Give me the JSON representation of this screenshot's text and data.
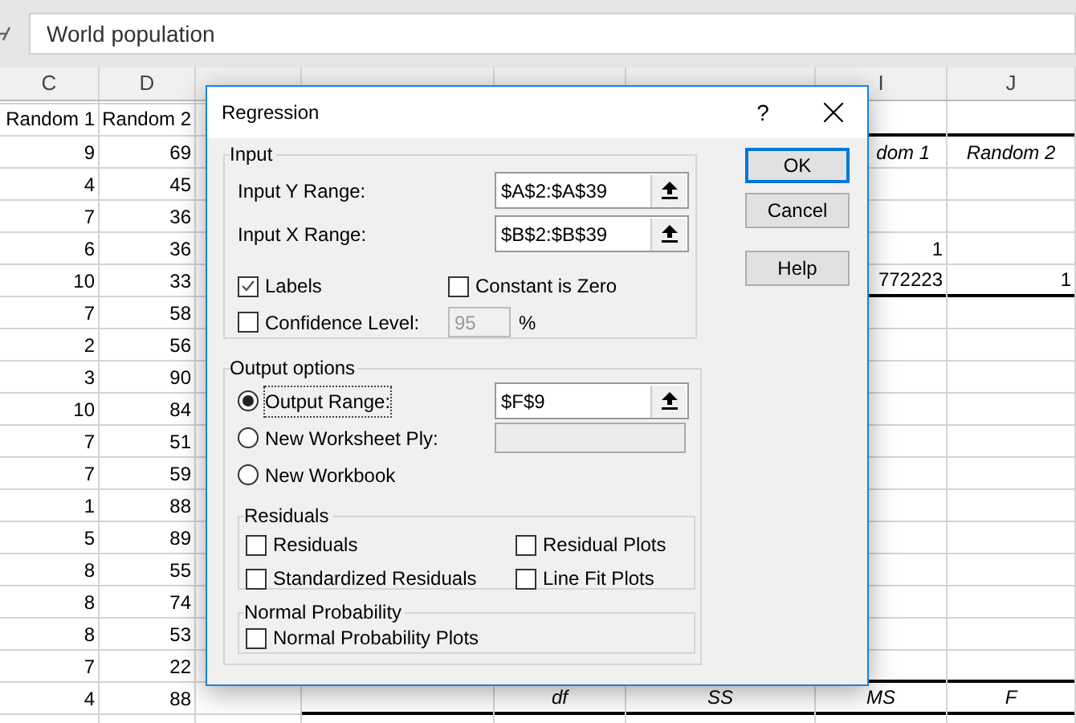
{
  "formula_bar": {
    "value": "World population"
  },
  "columns": [
    {
      "header": "C"
    },
    {
      "header": "D"
    },
    null,
    null,
    null,
    null,
    {
      "header": "I"
    },
    {
      "header": "J"
    }
  ],
  "rows": [
    {
      "cells": [
        {
          "text": "Random 1"
        },
        {
          "text": "Random 2"
        },
        null,
        null,
        null,
        null,
        {
          "rule": true
        },
        {
          "rule": true
        }
      ]
    },
    {
      "cells": [
        {
          "text": "9"
        },
        {
          "text": "69"
        },
        null,
        null,
        null,
        null,
        {
          "text": "dom 1",
          "italic": true,
          "kind": "cut"
        },
        {
          "text": "Random 2",
          "italic": true
        }
      ]
    },
    {
      "cells": [
        {
          "text": "4"
        },
        {
          "text": "45"
        }
      ]
    },
    {
      "cells": [
        {
          "text": "7"
        },
        {
          "text": "36"
        }
      ]
    },
    {
      "cells": [
        {
          "text": "6"
        },
        {
          "text": "36"
        },
        null,
        null,
        null,
        null,
        {
          "text": "1"
        }
      ]
    },
    {
      "cells": [
        {
          "text": "10"
        },
        {
          "text": "33"
        },
        null,
        null,
        null,
        null,
        {
          "text": "772223",
          "rule": true
        },
        {
          "text": "1",
          "rule": true
        }
      ]
    },
    {
      "cells": [
        {
          "text": "7"
        },
        {
          "text": "58"
        }
      ]
    },
    {
      "cells": [
        {
          "text": "2"
        },
        {
          "text": "56"
        }
      ]
    },
    {
      "cells": [
        {
          "text": "3"
        },
        {
          "text": "90"
        }
      ]
    },
    {
      "cells": [
        {
          "text": "10"
        },
        {
          "text": "84"
        }
      ]
    },
    {
      "cells": [
        {
          "text": "7"
        },
        {
          "text": "51"
        }
      ]
    },
    {
      "cells": [
        {
          "text": "7"
        },
        {
          "text": "59"
        }
      ]
    },
    {
      "cells": [
        {
          "text": "1"
        },
        {
          "text": "88"
        }
      ]
    },
    {
      "cells": [
        {
          "text": "5"
        },
        {
          "text": "89"
        }
      ]
    },
    {
      "cells": [
        {
          "text": "8"
        },
        {
          "text": "55"
        }
      ]
    },
    {
      "cells": [
        {
          "text": "8"
        },
        {
          "text": "74"
        }
      ]
    },
    {
      "cells": [
        {
          "text": "8"
        },
        {
          "text": "53"
        }
      ]
    },
    {
      "cells": [
        {
          "text": "7"
        },
        {
          "text": "22"
        },
        null,
        null,
        null,
        null,
        {
          "rule": true
        },
        {
          "rule": true
        }
      ]
    },
    {
      "cells": [
        {
          "text": "4"
        },
        {
          "text": "88"
        },
        null,
        {
          "rule": true
        },
        {
          "text": "df",
          "italic": true,
          "rule": true
        },
        {
          "text": "SS",
          "italic": true,
          "rule": true
        },
        {
          "text": "MS",
          "italic": true,
          "rule": true
        },
        {
          "text": "F",
          "italic": true,
          "rule": true
        }
      ]
    }
  ],
  "dialog": {
    "title": "Regression",
    "help_glyph": "?",
    "input": {
      "label": "Input",
      "ranges": [
        {
          "label": "Input Y Range:",
          "value": "$A$2:$A$39"
        },
        {
          "label": "Input X Range:",
          "value": "$B$2:$B$39"
        }
      ],
      "labels": {
        "label": "Labels",
        "checked": true
      },
      "constant_zero": {
        "label": "Constant is Zero",
        "checked": false
      },
      "confidence": {
        "label": "Confidence Level:",
        "checked": false,
        "value": "95",
        "disabled": true,
        "unit": "%"
      }
    },
    "output": {
      "label": "Output options",
      "options": [
        {
          "label": "Output Range:",
          "selected": true,
          "value": "$F$9",
          "kind": "range"
        },
        {
          "label": "New Worksheet Ply:",
          "selected": false,
          "kind": "text",
          "disabled": true
        },
        {
          "label": "New Workbook",
          "selected": false,
          "kind": "plain"
        }
      ],
      "residuals": {
        "label": "Residuals",
        "items": [
          {
            "label": "Residuals",
            "checked": false
          },
          {
            "label": "Residual Plots",
            "checked": false
          },
          {
            "label": "Standardized Residuals",
            "checked": false
          },
          {
            "label": "Line Fit Plots",
            "checked": false
          }
        ]
      },
      "normal": {
        "label": "Normal Probability",
        "items": [
          {
            "label": "Normal Probability Plots",
            "checked": false
          }
        ]
      }
    },
    "buttons": [
      {
        "label": "OK",
        "default": true
      },
      {
        "label": "Cancel",
        "default": false
      },
      {
        "label": "Help",
        "default": false
      }
    ]
  }
}
